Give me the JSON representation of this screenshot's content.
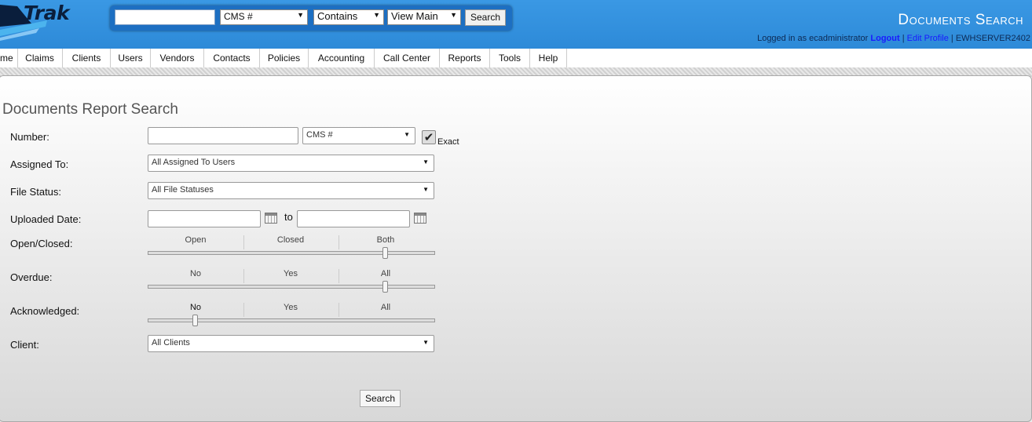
{
  "header": {
    "logo_text": "Trak",
    "search": {
      "input_value": "",
      "field_select": "CMS #",
      "match_select": "Contains",
      "view_select": "View Main",
      "button_label": "Search"
    },
    "page_title": "Documents Search",
    "login": {
      "prefix": "Logged in as ecadministrator",
      "logout": "Logout",
      "sep1": "|",
      "edit_profile": "Edit Profile",
      "sep2": "|",
      "server": "EWHSERVER2402"
    }
  },
  "nav": {
    "items": [
      "me",
      "Claims",
      "Clients",
      "Users",
      "Vendors",
      "Contacts",
      "Policies",
      "Accounting",
      "Call Center",
      "Reports",
      "Tools",
      "Help"
    ]
  },
  "form": {
    "title": "Documents Report Search",
    "number": {
      "label": "Number:",
      "value": "",
      "type_select": "CMS #",
      "exact_label": "Exact",
      "exact_checked": true
    },
    "assigned_to": {
      "label": "Assigned To:",
      "value": "All Assigned To Users"
    },
    "file_status": {
      "label": "File Status:",
      "value": "All File Statuses"
    },
    "uploaded_date": {
      "label": "Uploaded Date:",
      "from": "",
      "to_label": "to",
      "to": ""
    },
    "open_closed": {
      "label": "Open/Closed:",
      "options": [
        "Open",
        "Closed",
        "Both"
      ],
      "selected": "Both"
    },
    "overdue": {
      "label": "Overdue:",
      "options": [
        "No",
        "Yes",
        "All"
      ],
      "selected": "All"
    },
    "acknowledged": {
      "label": "Acknowledged:",
      "options": [
        "No",
        "Yes",
        "All"
      ],
      "selected": "No"
    },
    "client": {
      "label": "Client:",
      "value": "All Clients"
    },
    "search_button": "Search"
  }
}
